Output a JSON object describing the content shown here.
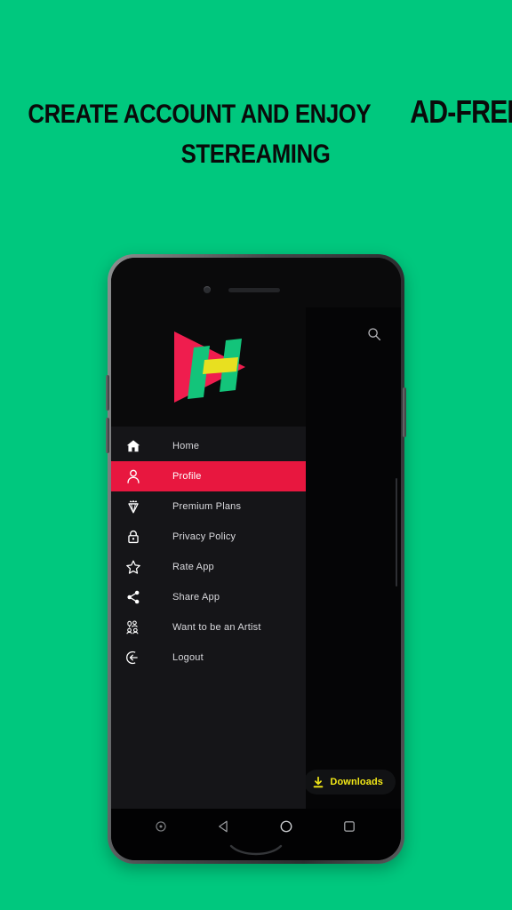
{
  "promo": {
    "line1_part1": "CREATE ACCOUNT AND ENJOY ",
    "line1_part2": "AD-FREE",
    "line2": "STEREAMING",
    "text_color": "#0a0a0a",
    "background_color": "#00c87e"
  },
  "phone": {
    "frame_color": "#45474a",
    "screen_background": "#050506",
    "camera_icon": "camera-dot",
    "speaker_icon": "earpiece-speaker"
  },
  "app": {
    "logo": {
      "name": "app-logo",
      "description": "play triangle with H monogram",
      "colors": {
        "triangle": "#ef1d4e",
        "bars": "#13c47a",
        "crossbar": "#e8e020"
      }
    },
    "search_icon": "search-icon",
    "drawer": {
      "background_color": "#151518",
      "active_color": "#e8173f",
      "items": [
        {
          "label": "Home",
          "icon": "home-icon",
          "active": false
        },
        {
          "label": "Profile",
          "icon": "person-icon",
          "active": true
        },
        {
          "label": "Premium Plans",
          "icon": "diamond-crown-icon",
          "active": false
        },
        {
          "label": "Privacy Policy",
          "icon": "lock-icon",
          "active": false
        },
        {
          "label": "Rate App",
          "icon": "star-icon",
          "active": false
        },
        {
          "label": "Share App",
          "icon": "share-icon",
          "active": false
        },
        {
          "label": "Want to be an Artist",
          "icon": "artist-microphone-icon",
          "active": false
        },
        {
          "label": "Logout",
          "icon": "logout-icon",
          "active": false
        }
      ]
    },
    "downloads": {
      "label": "Downloads",
      "icon": "download-icon",
      "color": "#f2e817"
    }
  },
  "navbar": {
    "assistant_icon": "assistant-dot-icon",
    "back_icon": "back-triangle-icon",
    "home_icon": "home-circle-icon",
    "recents_icon": "recents-square-icon"
  }
}
